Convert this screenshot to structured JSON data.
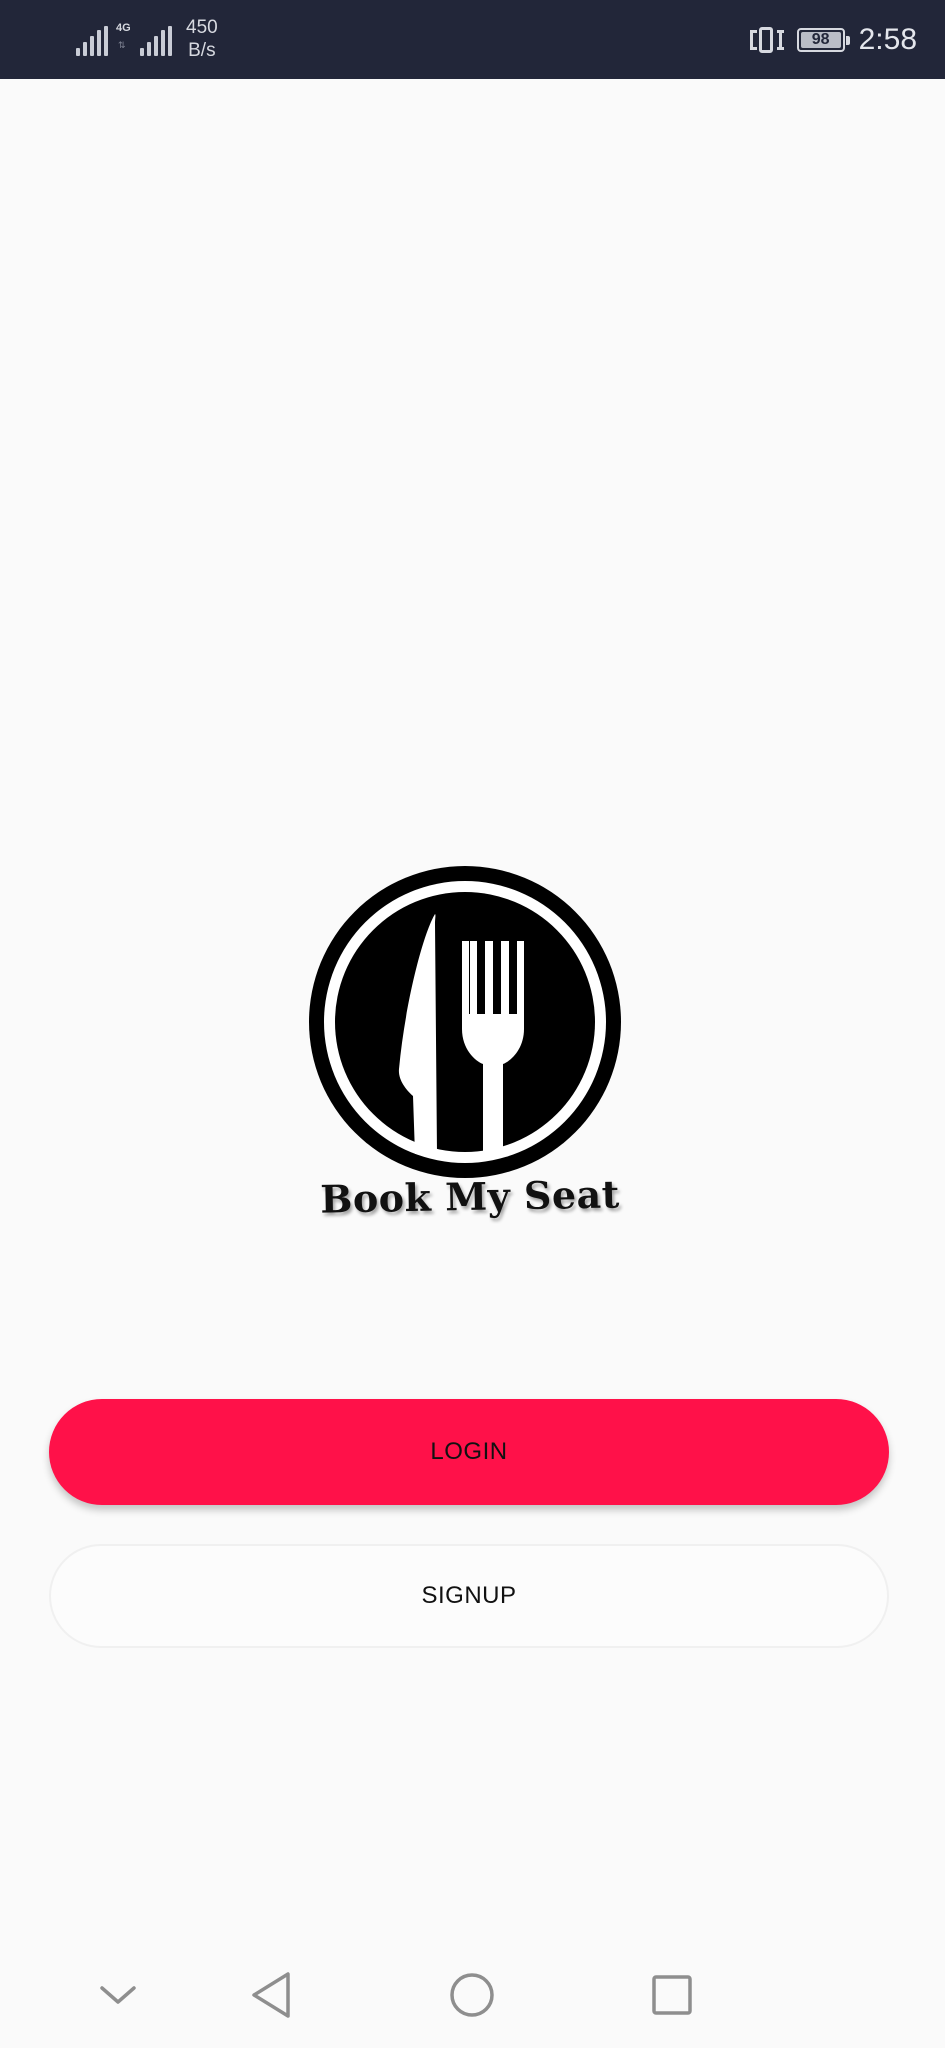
{
  "status_bar": {
    "network_type": "4G",
    "speed_value": "450",
    "speed_unit": "B/s",
    "battery_level": "98",
    "time": "2:58",
    "icons": [
      "signal-icon",
      "signal-icon",
      "vibrate-icon",
      "battery-icon"
    ]
  },
  "logo": {
    "brand_name": "Book My Seat",
    "icon": "knife-fork-icon"
  },
  "actions": {
    "login_label": "LOGIN",
    "signup_label": "SIGNUP"
  },
  "colors": {
    "accent": "#ff1149",
    "status_bar_bg": "#222639",
    "background": "#fafafa"
  },
  "nav_bar": {
    "icons": [
      "chevron-down-icon",
      "back-icon",
      "home-icon",
      "recents-icon"
    ]
  }
}
